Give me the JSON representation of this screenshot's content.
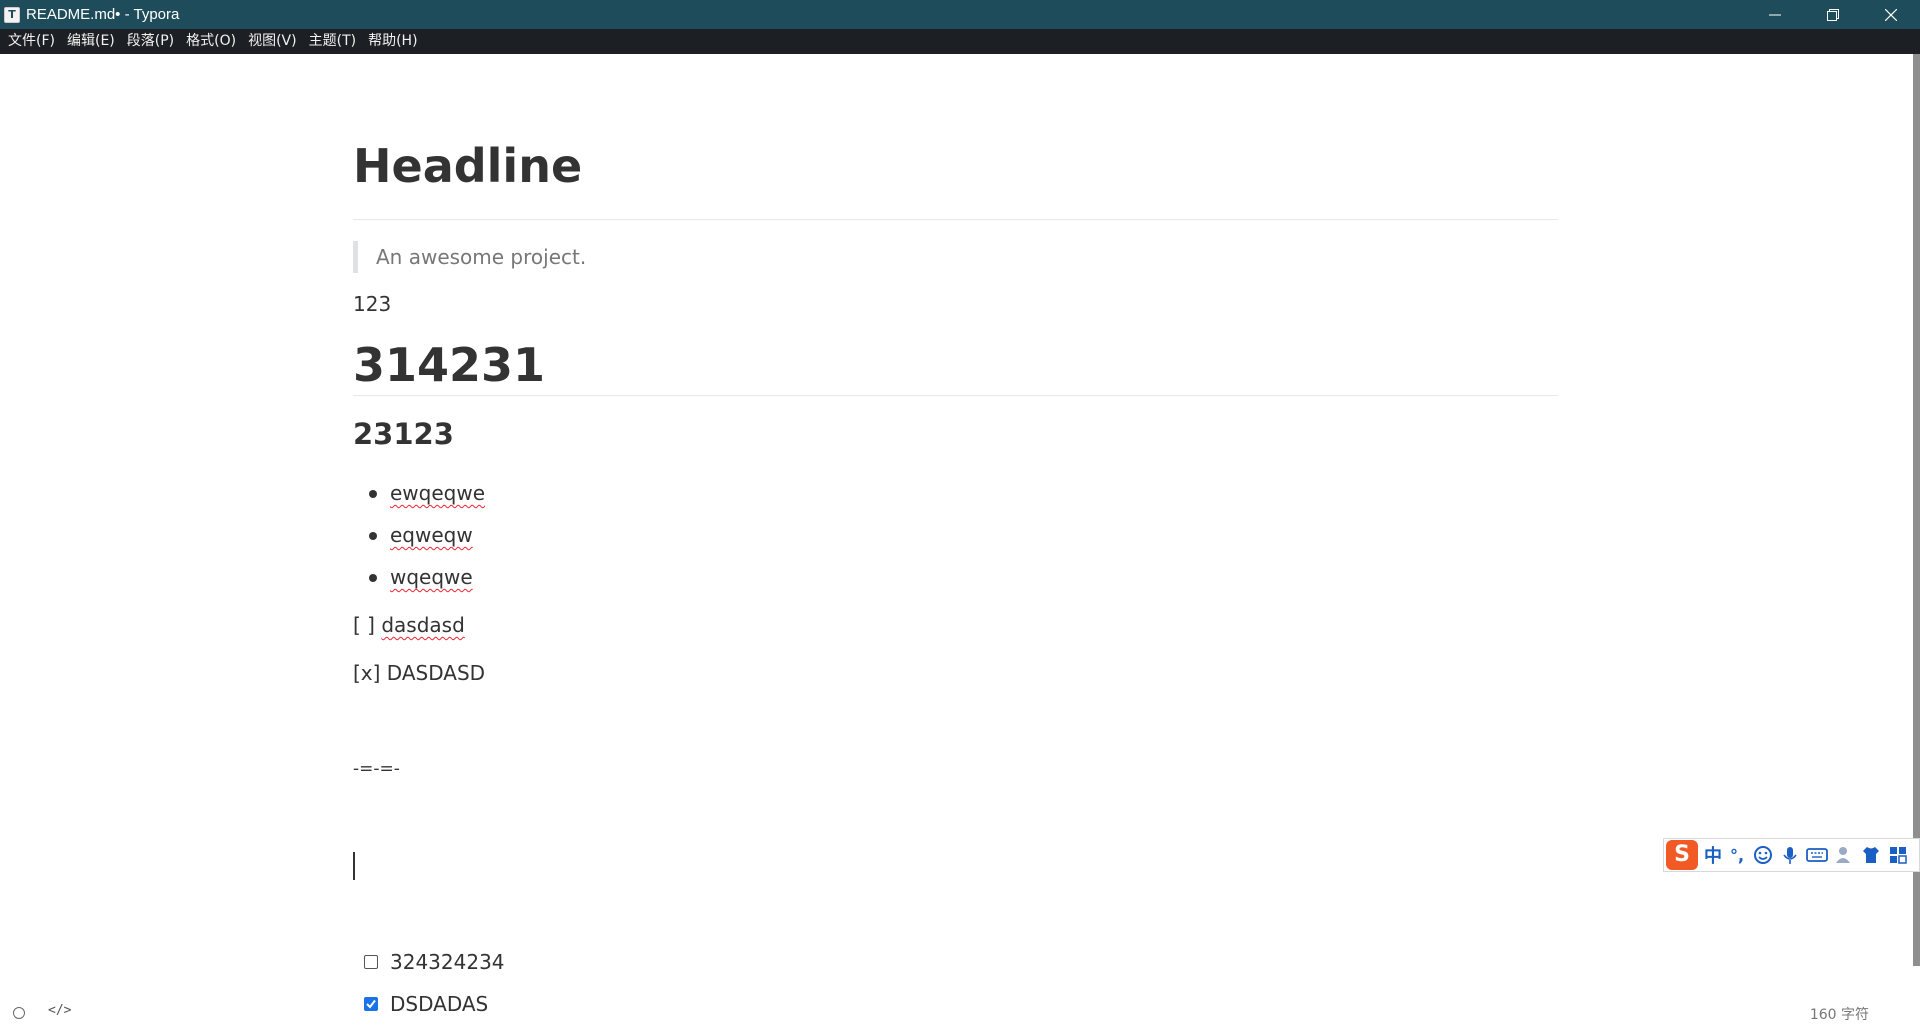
{
  "window": {
    "title": "README.md• - Typora",
    "app_icon_letter": "T"
  },
  "menu": [
    "文件(F)",
    "编辑(E)",
    "段落(P)",
    "格式(O)",
    "视图(V)",
    "主题(T)",
    "帮助(H)"
  ],
  "document": {
    "headline": "Headline",
    "quote": "An awesome project.",
    "para1": "123",
    "heading2": "314231",
    "heading3": "23123",
    "bullets": [
      "ewqeqwe",
      "eqweqw",
      "wqeqwe"
    ],
    "task_raw_open_prefix": "[ ] ",
    "task_raw_open_text": "dasdasd",
    "task_raw_done": "[x] DASDASD",
    "separator_text": "-=-=-",
    "tasks": [
      {
        "text": "324324234",
        "checked": false
      },
      {
        "text": "DSDADAS",
        "checked": true
      }
    ]
  },
  "ime": {
    "logo": "S",
    "mode": "中",
    "punct": "°,"
  },
  "status": {
    "code_toggle": "</>",
    "char_count": "160 字符"
  },
  "colors": {
    "titlebar": "#1f4c5a",
    "menubar": "#1c1f23",
    "checkbox_checked": "#1a73e8",
    "ime_logo": "#f15a24"
  }
}
